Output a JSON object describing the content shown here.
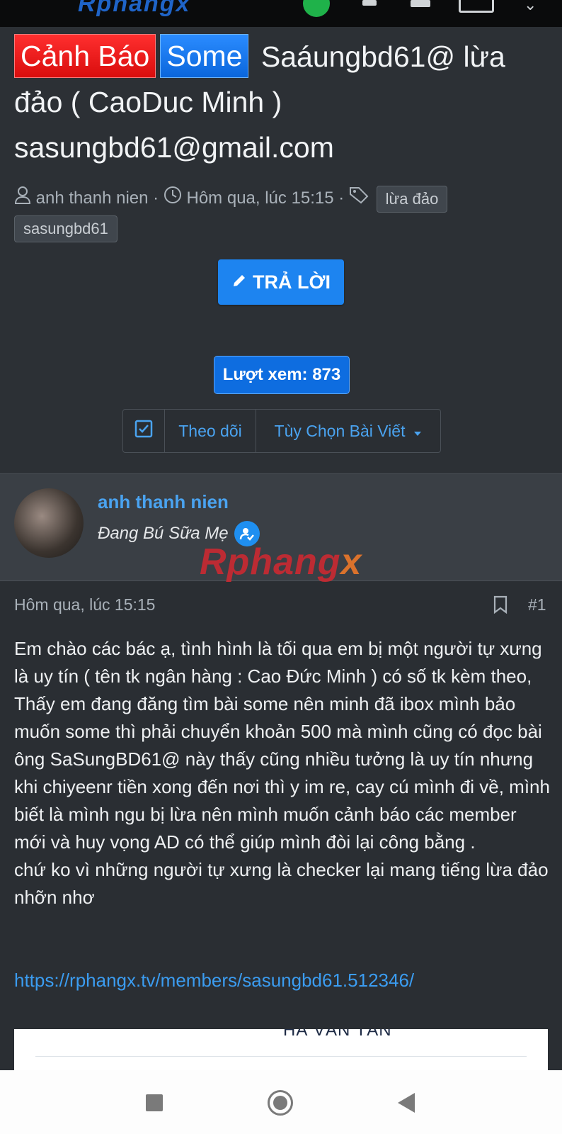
{
  "statusbar": {
    "logo_text": "Rphangx"
  },
  "thread": {
    "prefix_warning": "Cảnh Báo",
    "prefix_some": "Some",
    "title": "Saáungbd61@ lừa đảo ( CaoDuc Minh ) sasungbd61@gmail.com",
    "author": "anh thanh nien",
    "date": "Hôm qua, lúc 15:15",
    "tags": [
      "lừa đảo",
      "sasungbd61"
    ],
    "reply_label": "TRẢ LỜI",
    "views_label": "Lượt xem: 873",
    "follow_label": "Theo dõi",
    "options_label": "Tùy Chọn Bài Viết",
    "colors": {
      "warning": "#ff2f2f",
      "some": "#0a66dc",
      "accent": "#1d84f0",
      "link": "#3b9cf0"
    }
  },
  "post": {
    "username": "anh thanh nien",
    "user_title": "Đang Bú Sữa Mẹ",
    "watermark": "Rphang",
    "watermark_x": "x",
    "date": "Hôm qua, lúc 15:15",
    "number": "#1",
    "body": "Em chào các bác ạ, tình hình là tối qua em bị một người tự xưng là uy tín ( tên tk ngân hàng : Cao Đức Minh ) có số tk kèm theo,\nThấy em đang đăng tìm bài some nên minh đã ibox mình bảo muốn some thì phải chuyển khoản 500 mà mình cũng có đọc bài ông SaSungBD61@ này thấy cũng nhiều tưởng là uy tín nhưng khi chiyeenr tiền xong đến nơi thì y im re, cay cú mình đi về, mình biết là mình ngu bị lừa nên mình muốn cảnh báo các member mới và huy vọng AD có thể giúp mình đòi lại công bằng .\nchứ ko vì những người tự xưng là checker lại mang tiếng lừa đảo nhỡn nhơ",
    "link": "https://rphangx.tv/members/sasungbd61.512346/",
    "embed_text": "HÀ VĂN TÂN"
  },
  "icons": [
    "user-icon",
    "clock-icon",
    "tag-icon",
    "pencil-icon",
    "checkbox-icon",
    "caret-down-icon",
    "verified-user-icon",
    "bookmark-icon"
  ]
}
